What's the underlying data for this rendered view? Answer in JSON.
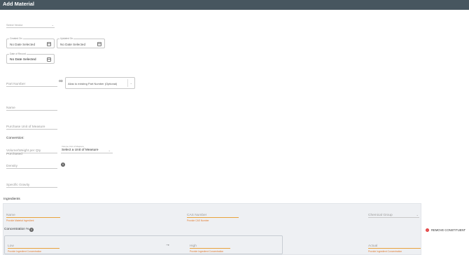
{
  "header": {
    "title": "Add Material"
  },
  "vendor": {
    "label": "Select Vendor"
  },
  "dates": {
    "created": {
      "label": "Created On",
      "value": "No Date Selected"
    },
    "updated": {
      "label": "Updated On",
      "value": "No Date Selected"
    },
    "record": {
      "label": "Date of Record",
      "value": "No Date Selected"
    }
  },
  "part_number": {
    "label": "Part Number",
    "alias_placeholder": "Alias to existing Part Number (Optional)"
  },
  "name": {
    "label": "Name"
  },
  "purchase_uom": {
    "label": "Purchase Unit of Measure"
  },
  "conversion": {
    "title": "Conversion:",
    "volume_label": "Volume/Weight per Qty Purchased",
    "uom_label": "Volume Unit of Measure",
    "uom_value": "Select a Unit of Measure"
  },
  "density": {
    "label": "Density"
  },
  "specific_gravity": {
    "label": "Specific Gravity"
  },
  "ingredients": {
    "title": "Ingredients",
    "name_label": "Name",
    "name_error": "Provide Material Ingredient",
    "cas_label": "CAS Number",
    "cas_error": "Provide CAS Number",
    "chemical_group_label": "Chemical Group",
    "concentration_label": "Concentration %",
    "low_label": "Low",
    "low_error": "Provide Ingredient Concentration",
    "arrow": "→",
    "high_label": "High",
    "high_error": "Provide Ingredient Concentration",
    "actual_label": "Actual",
    "actual_error": "Provide Ingredient Concentration",
    "remove_label": "REMOVE CONSTITUENT"
  }
}
